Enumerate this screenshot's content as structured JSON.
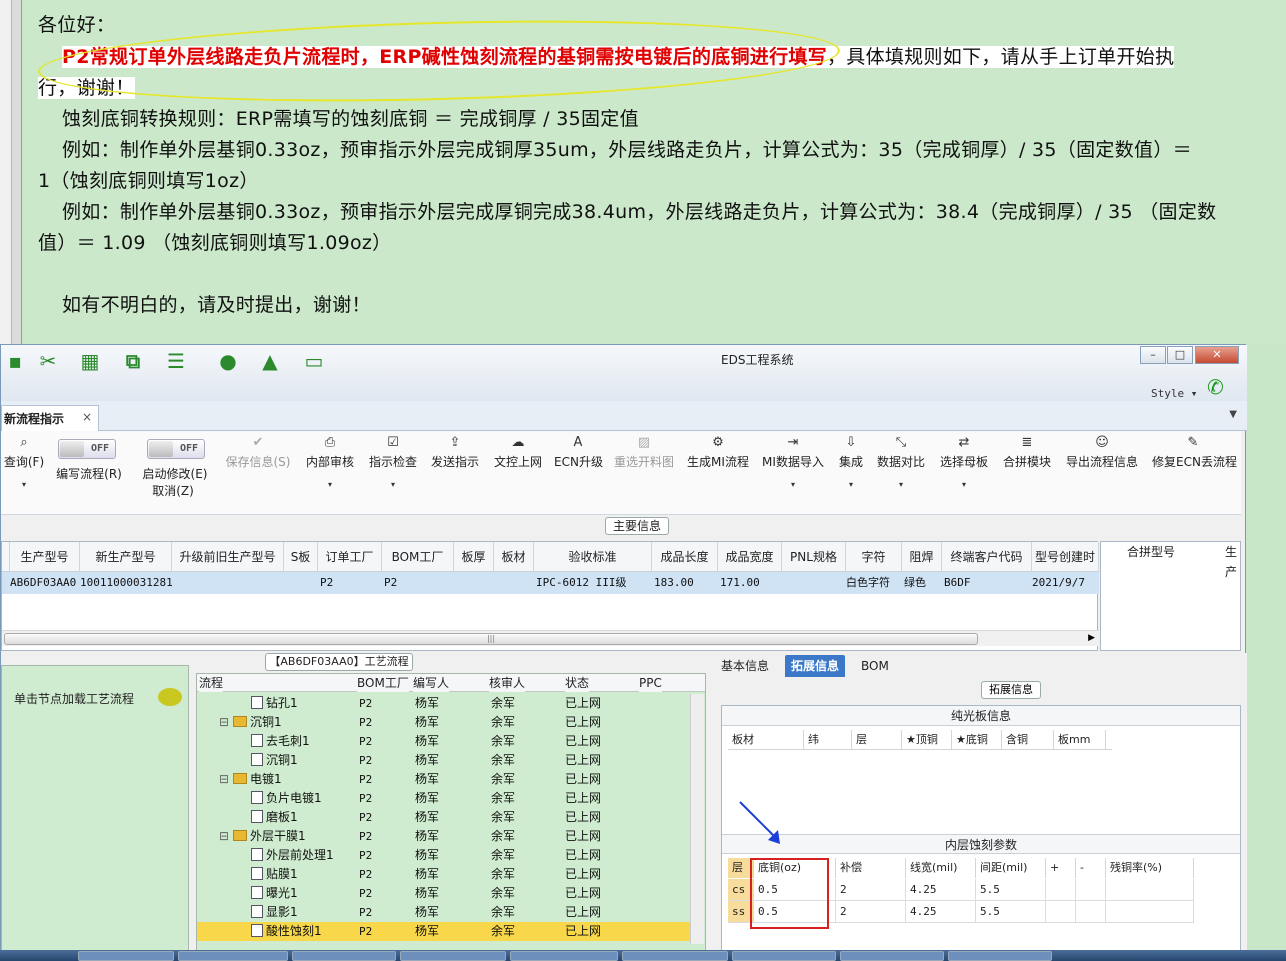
{
  "mail": {
    "greeting": "各位好：",
    "line1_red": "P2常规订单外层线路走负片流程时，ERP碱性蚀刻流程的基铜需按电镀后的底铜进行填写",
    "line1_rest": "，具体填规则如下，请从手上订单开始执",
    "line2": "行，谢谢！",
    "line3": "蚀刻底铜转换规则：ERP需填写的蚀刻底铜 ＝ 完成铜厚 / 35固定值",
    "line4": "例如：制作单外层基铜0.33oz，预审指示外层完成铜厚35um，外层线路走负片，计算公式为：35（完成铜厚）/ 35（固定数值）＝",
    "line5": "1（蚀刻底铜则填写1oz）",
    "line6": "例如：制作单外层基铜0.33oz，预审指示外层完成厚铜完成38.4um，外层线路走负片，计算公式为：38.4（完成铜厚）/ 35 （固定数",
    "line7": "值）＝ 1.09 （蚀刻底铜则填写1.09oz）",
    "line8": "如有不明白的，请及时提出，谢谢！"
  },
  "window": {
    "title": "EDS工程系统",
    "style_label": "Style",
    "tab_label": "新流程指示",
    "tab_close": "×"
  },
  "toggles": {
    "off": "OFF"
  },
  "ribbon": {
    "query": "查询(F)",
    "edit_flow": "编写流程(R)",
    "start_modify": "启动修改(E)",
    "cancel": "取消(Z)",
    "save": "保存信息(S)",
    "internal_review": "内部审核",
    "check_indicator": "指示检查",
    "send_indicator": "发送指示",
    "doc_upload": "文控上网",
    "ecn_upgrade": "ECN升级",
    "reset_cut_map": "重选开料图",
    "gen_mi": "生成MI流程",
    "mi_import": "MI数据导入",
    "integrate": "集成",
    "data_compare": "数据对比",
    "select_master": "选择母板",
    "merge_module": "合拼模块",
    "export_flow": "导出流程信息",
    "fix_ecn": "修复ECN丢流程"
  },
  "main_info_label": "主要信息",
  "grid": {
    "columns": [
      "生产型号",
      "新生产型号",
      "升级前旧生产型号",
      "S板",
      "订单工厂",
      "BOM工厂",
      "板厚",
      "板材",
      "验收标准",
      "成品长度",
      "成品宽度",
      "PNL规格",
      "字符",
      "阻焊",
      "终端客户代码",
      "型号创建时"
    ],
    "row": [
      "AB6DF03AA0",
      "10011000031281",
      "",
      "",
      "P2",
      "P2",
      "",
      "",
      "IPC-6012 III级",
      "183.00",
      "171.00",
      "",
      "白色字符",
      "绿色",
      "B6DF",
      "2021/9/7"
    ],
    "side_columns": [
      "合拼型号",
      "生产"
    ],
    "scroll_mark": "|||"
  },
  "flow": {
    "title": "【AB6DF03AA0】工艺流程",
    "left_hint": "单击节点加载工艺流程",
    "columns": [
      "流程",
      "BOM工厂",
      "编写人",
      "核审人",
      "状态",
      "PPC"
    ],
    "rows": [
      {
        "name": "钻孔1",
        "indent": 2,
        "folder": false,
        "bom": "P2",
        "writer": "杨军",
        "reviewer": "余军",
        "status": "已上网"
      },
      {
        "name": "沉铜1",
        "indent": 1,
        "folder": true,
        "bom": "P2",
        "writer": "杨军",
        "reviewer": "余军",
        "status": "已上网"
      },
      {
        "name": "去毛刺1",
        "indent": 2,
        "folder": false,
        "bom": "P2",
        "writer": "杨军",
        "reviewer": "余军",
        "status": "已上网"
      },
      {
        "name": "沉铜1",
        "indent": 2,
        "folder": false,
        "bom": "P2",
        "writer": "杨军",
        "reviewer": "余军",
        "status": "已上网"
      },
      {
        "name": "电镀1",
        "indent": 1,
        "folder": true,
        "bom": "P2",
        "writer": "杨军",
        "reviewer": "余军",
        "status": "已上网"
      },
      {
        "name": "负片电镀1",
        "indent": 2,
        "folder": false,
        "bom": "P2",
        "writer": "杨军",
        "reviewer": "余军",
        "status": "已上网"
      },
      {
        "name": "磨板1",
        "indent": 2,
        "folder": false,
        "bom": "P2",
        "writer": "杨军",
        "reviewer": "余军",
        "status": "已上网"
      },
      {
        "name": "外层干膜1",
        "indent": 1,
        "folder": true,
        "bom": "P2",
        "writer": "杨军",
        "reviewer": "余军",
        "status": "已上网"
      },
      {
        "name": "外层前处理1",
        "indent": 2,
        "folder": false,
        "bom": "P2",
        "writer": "杨军",
        "reviewer": "余军",
        "status": "已上网"
      },
      {
        "name": "贴膜1",
        "indent": 2,
        "folder": false,
        "bom": "P2",
        "writer": "杨军",
        "reviewer": "余军",
        "status": "已上网"
      },
      {
        "name": "曝光1",
        "indent": 2,
        "folder": false,
        "bom": "P2",
        "writer": "杨军",
        "reviewer": "余军",
        "status": "已上网"
      },
      {
        "name": "显影1",
        "indent": 2,
        "folder": false,
        "bom": "P2",
        "writer": "杨军",
        "reviewer": "余军",
        "status": "已上网"
      },
      {
        "name": "酸性蚀刻1",
        "indent": 2,
        "folder": false,
        "bom": "P2",
        "writer": "杨军",
        "reviewer": "余军",
        "status": "已上网",
        "selected": true
      }
    ]
  },
  "right": {
    "tabs": [
      "基本信息",
      "拓展信息",
      "BOM"
    ],
    "ext_title": "拓展信息",
    "plain_board_title": "纯光板信息",
    "plain_cols": [
      "板材",
      "纬",
      "层",
      "★顶铜",
      "★底铜",
      "含铜",
      "板mm"
    ],
    "inner_title": "内层蚀刻参数",
    "inner_cols": [
      "层",
      "底铜(oz)",
      "补偿",
      "线宽(mil)",
      "间距(mil)",
      "+",
      "-",
      "残铜率(%)"
    ],
    "inner_rows": [
      [
        "cs",
        "0.5",
        "2",
        "4.25",
        "5.5",
        "",
        "",
        ""
      ],
      [
        "ss",
        "0.5",
        "2",
        "4.25",
        "5.5",
        "",
        "",
        ""
      ]
    ]
  },
  "colors": {
    "accent": "#3c78c8",
    "highlight_red": "#e00000",
    "selected_row": "#f8d84a",
    "background_green": "#c8e6c8"
  }
}
